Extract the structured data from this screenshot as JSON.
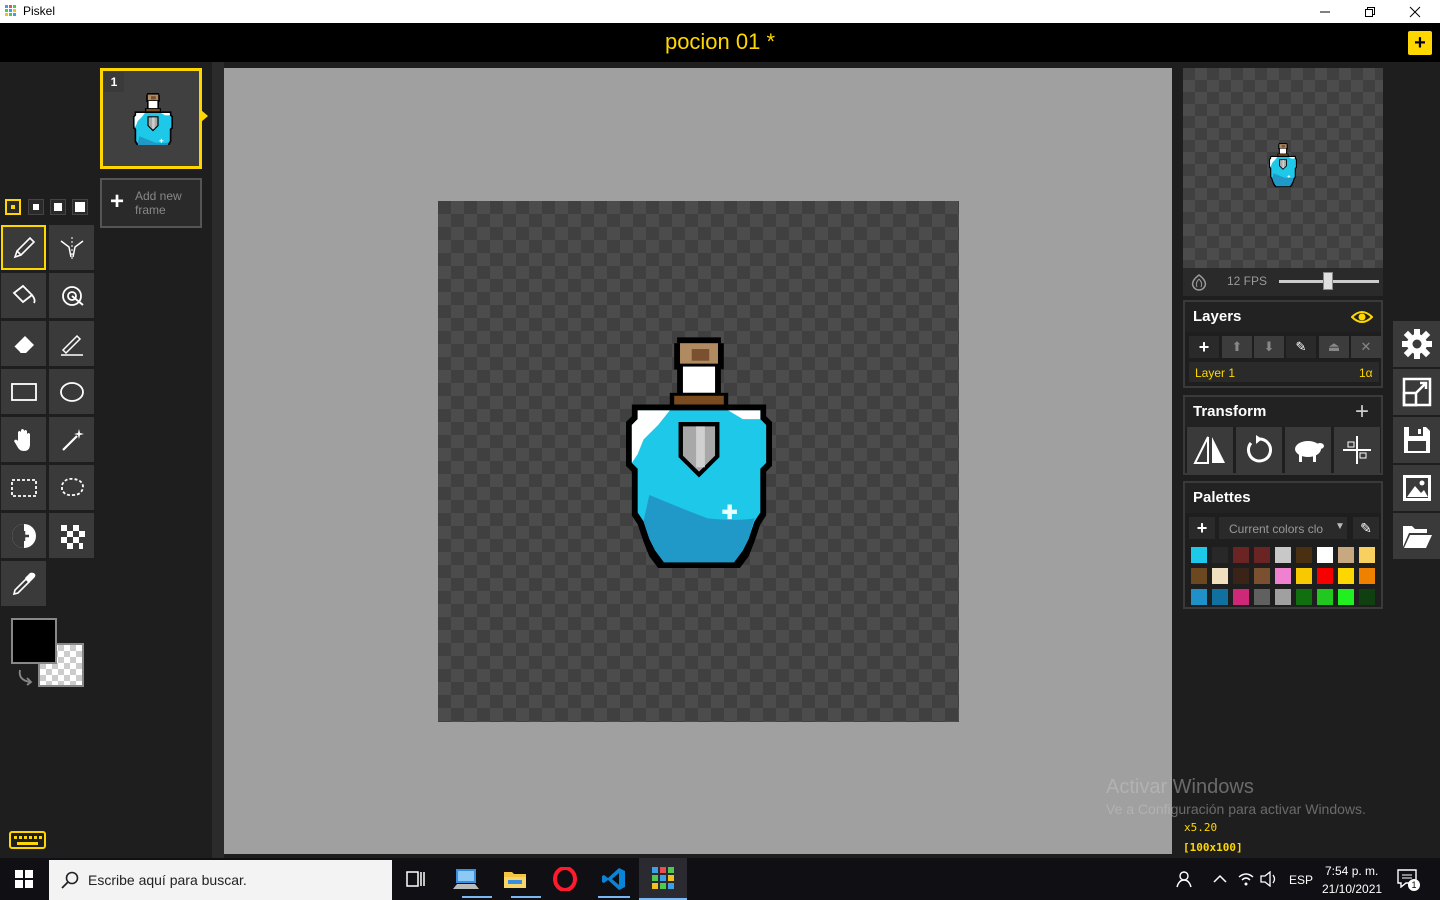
{
  "window": {
    "app_name": "Piskel",
    "controls": [
      "minimize",
      "restore",
      "close"
    ]
  },
  "header": {
    "doc_title": "pocion 01 *",
    "new_button": "+"
  },
  "tools": {
    "pen_sizes": [
      1,
      2,
      3,
      4
    ],
    "items": [
      {
        "name": "pen-tool",
        "icon": "pencil-icon",
        "active": true
      },
      {
        "name": "vertical-mirror-pen-tool",
        "icon": "mirror-pen-icon"
      },
      {
        "name": "paint-bucket-tool",
        "icon": "bucket-icon"
      },
      {
        "name": "paint-all-same-color-tool",
        "icon": "spray-icon"
      },
      {
        "name": "eraser-tool",
        "icon": "eraser-icon"
      },
      {
        "name": "stroke-tool",
        "icon": "line-icon"
      },
      {
        "name": "rectangle-tool",
        "icon": "rectangle-icon"
      },
      {
        "name": "circle-tool",
        "icon": "circle-icon"
      },
      {
        "name": "move-tool",
        "icon": "hand-icon"
      },
      {
        "name": "shape-selection-tool",
        "icon": "magic-wand-icon"
      },
      {
        "name": "rectangle-selection-tool",
        "icon": "rect-select-icon"
      },
      {
        "name": "lasso-selection-tool",
        "icon": "lasso-icon"
      },
      {
        "name": "lighten-tool",
        "icon": "lighten-icon"
      },
      {
        "name": "dithering-tool",
        "icon": "dither-icon"
      },
      {
        "name": "color-picker-tool",
        "icon": "eyedropper-icon"
      }
    ],
    "primary_color": "#000000",
    "secondary_color": "transparent"
  },
  "frames": {
    "frame_number": "1",
    "add_frame_line1": "Add new",
    "add_frame_line2": "frame"
  },
  "preview": {
    "fps_label": "12 FPS",
    "fps_value": 12
  },
  "layers": {
    "title": "Layers",
    "items": [
      {
        "name": "Layer 1",
        "opacity": "1α"
      }
    ]
  },
  "transform": {
    "title": "Transform"
  },
  "palettes": {
    "title": "Palettes",
    "selected": "Current colors clo",
    "colors": [
      "#1ec8e8",
      "#282828",
      "#6b2424",
      "#6b2424",
      "#c8c8c8",
      "#4a3010",
      "#ffffff",
      "#c8a880",
      "#f8d060",
      "#6b4820",
      "#f0e0c0",
      "#3a2418",
      "#7a5030",
      "#f080d0",
      "#f8c800",
      "#f80000",
      "#ffd700",
      "#f08000",
      "#2090c8",
      "#1070a0",
      "#d02878",
      "#606060",
      "#a0a0a0",
      "#107010",
      "#20c820",
      "#20f020",
      "#104010"
    ]
  },
  "canvas_info": {
    "zoom": "x5.20",
    "size": "[100x100]"
  },
  "watermark": {
    "line1": "Activar Windows",
    "line2": "Ve a Configuración para activar Windows."
  },
  "taskbar": {
    "search_placeholder": "Escribe aquí para buscar.",
    "language": "ESP",
    "time": "7:54 p. m.",
    "date": "21/10/2021",
    "notifications": "1"
  }
}
